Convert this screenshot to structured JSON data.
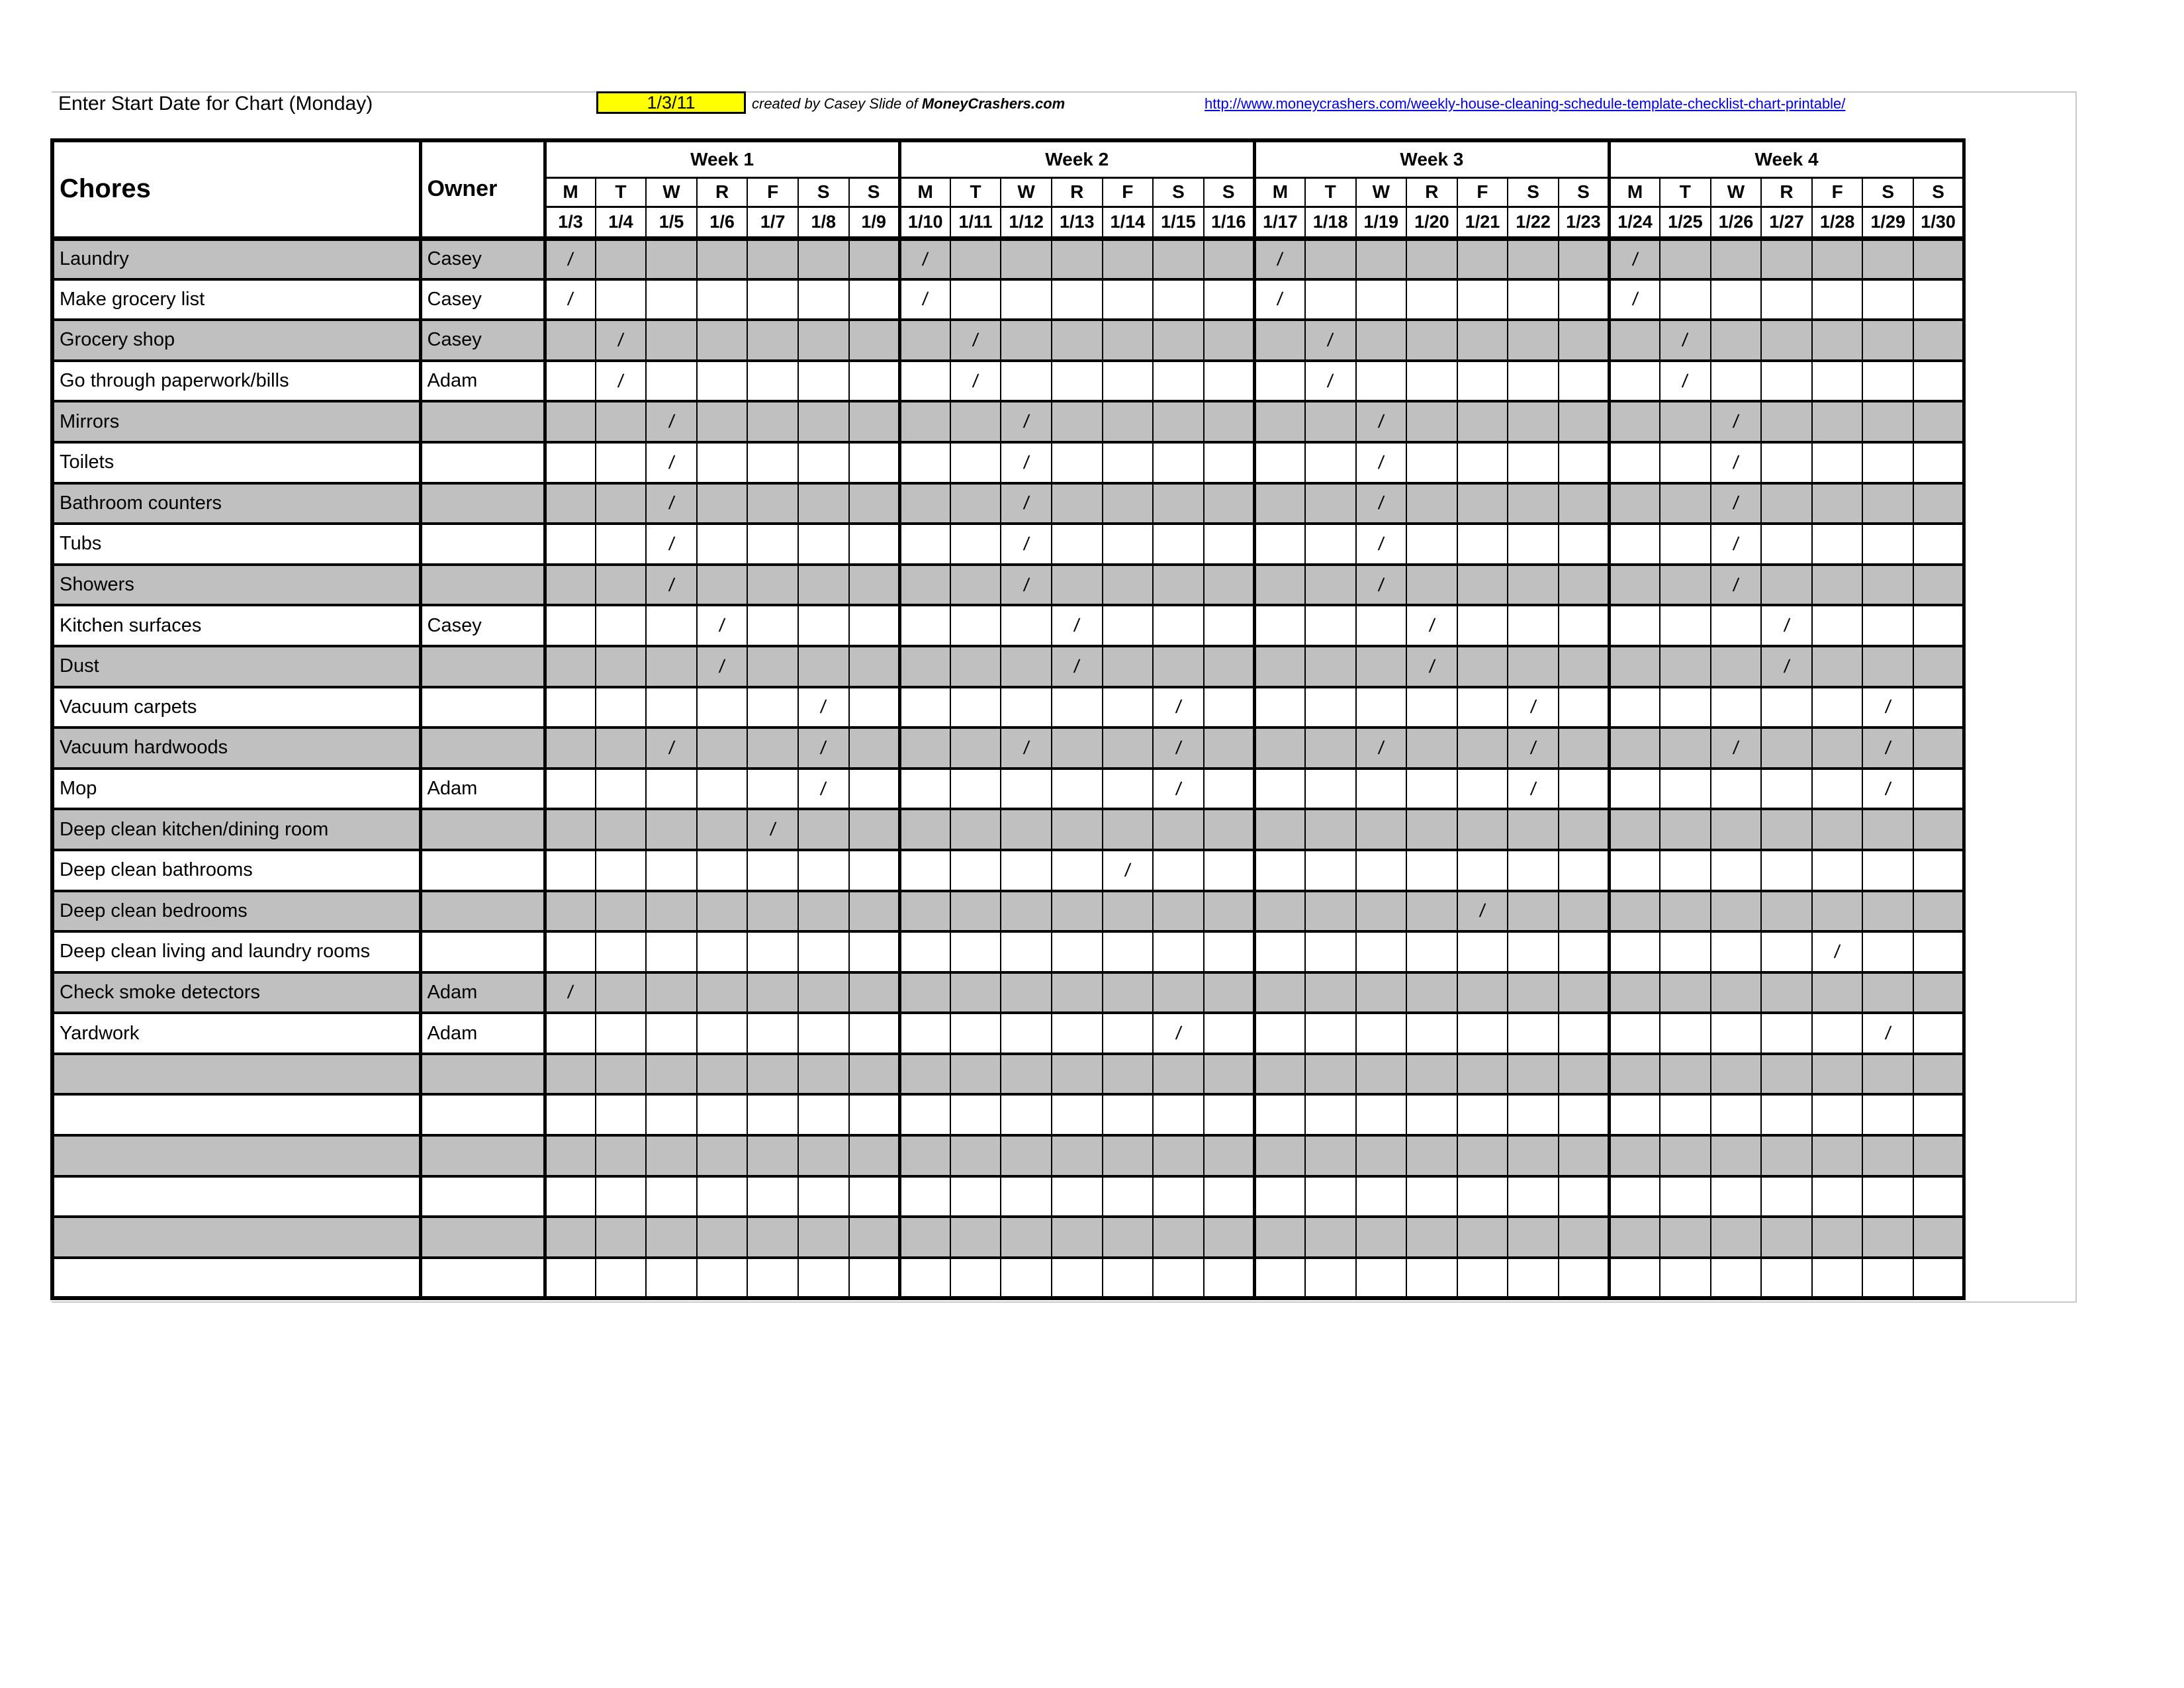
{
  "header": {
    "start_label": "Enter Start Date for Chart (Monday)",
    "start_value": "1/3/11",
    "credit_prefix": "created by Casey Slide of ",
    "credit_site": "MoneyCrashers.com",
    "url": "http://www.moneycrashers.com/weekly-house-cleaning-schedule-template-checklist-chart-printable/"
  },
  "colors": {
    "shaded_row": "#c0c0c0",
    "start_date_fill": "#ffff00",
    "link": "#0000ee"
  },
  "table": {
    "chores_header": "Chores",
    "owner_header": "Owner",
    "weeks": [
      "Week 1",
      "Week 2",
      "Week 3",
      "Week 4"
    ],
    "day_letters": [
      "M",
      "T",
      "W",
      "R",
      "F",
      "S",
      "S"
    ],
    "dates": [
      "1/3",
      "1/4",
      "1/5",
      "1/6",
      "1/7",
      "1/8",
      "1/9",
      "1/10",
      "1/11",
      "1/12",
      "1/13",
      "1/14",
      "1/15",
      "1/16",
      "1/17",
      "1/18",
      "1/19",
      "1/20",
      "1/21",
      "1/22",
      "1/23",
      "1/24",
      "1/25",
      "1/26",
      "1/27",
      "1/28",
      "1/29",
      "1/30"
    ],
    "mark_symbol": "/",
    "rows": [
      {
        "chore": "Laundry",
        "owner": "Casey",
        "marks": [
          0,
          7,
          14,
          21
        ]
      },
      {
        "chore": "Make grocery list",
        "owner": "Casey",
        "marks": [
          0,
          7,
          14,
          21
        ]
      },
      {
        "chore": "Grocery shop",
        "owner": "Casey",
        "marks": [
          1,
          8,
          15,
          22
        ]
      },
      {
        "chore": "Go through paperwork/bills",
        "owner": "Adam",
        "marks": [
          1,
          8,
          15,
          22
        ]
      },
      {
        "chore": "Mirrors",
        "owner": "",
        "marks": [
          2,
          9,
          16,
          23
        ]
      },
      {
        "chore": "Toilets",
        "owner": "",
        "marks": [
          2,
          9,
          16,
          23
        ]
      },
      {
        "chore": "Bathroom counters",
        "owner": "",
        "marks": [
          2,
          9,
          16,
          23
        ]
      },
      {
        "chore": "Tubs",
        "owner": "",
        "marks": [
          2,
          9,
          16,
          23
        ]
      },
      {
        "chore": "Showers",
        "owner": "",
        "marks": [
          2,
          9,
          16,
          23
        ]
      },
      {
        "chore": "Kitchen surfaces",
        "owner": "Casey",
        "marks": [
          3,
          10,
          17,
          24
        ]
      },
      {
        "chore": "Dust",
        "owner": "",
        "marks": [
          3,
          10,
          17,
          24
        ]
      },
      {
        "chore": "Vacuum carpets",
        "owner": "",
        "marks": [
          5,
          12,
          19,
          26
        ]
      },
      {
        "chore": "Vacuum hardwoods",
        "owner": "",
        "marks": [
          2,
          5,
          9,
          12,
          16,
          19,
          23,
          26
        ]
      },
      {
        "chore": "Mop",
        "owner": "Adam",
        "marks": [
          5,
          12,
          19,
          26
        ]
      },
      {
        "chore": "Deep clean kitchen/dining room",
        "owner": "",
        "marks": [
          4
        ]
      },
      {
        "chore": "Deep clean bathrooms",
        "owner": "",
        "marks": [
          11
        ]
      },
      {
        "chore": "Deep clean bedrooms",
        "owner": "",
        "marks": [
          18
        ]
      },
      {
        "chore": "Deep clean living and laundry rooms",
        "owner": "",
        "marks": [
          25
        ]
      },
      {
        "chore": "Check smoke detectors",
        "owner": "Adam",
        "marks": [
          0
        ]
      },
      {
        "chore": "Yardwork",
        "owner": "Adam",
        "marks": [
          12,
          26
        ]
      },
      {
        "chore": "",
        "owner": "",
        "marks": []
      },
      {
        "chore": "",
        "owner": "",
        "marks": []
      },
      {
        "chore": "",
        "owner": "",
        "marks": []
      },
      {
        "chore": "",
        "owner": "",
        "marks": []
      },
      {
        "chore": "",
        "owner": "",
        "marks": []
      },
      {
        "chore": "",
        "owner": "",
        "marks": []
      }
    ]
  }
}
